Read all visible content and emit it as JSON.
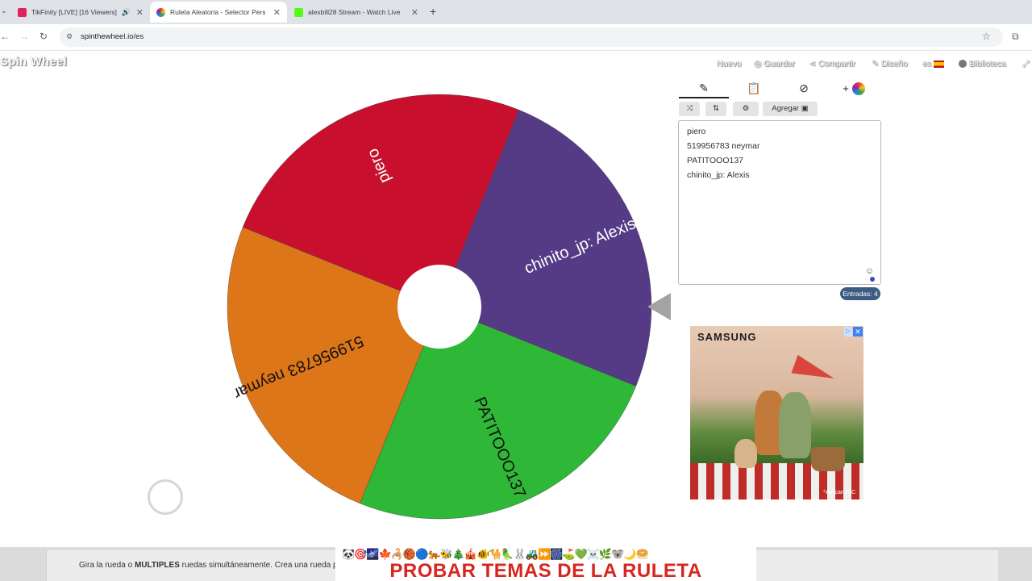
{
  "browser": {
    "tabs": [
      {
        "title": "TikFinity [LIVE] [16 Viewers]",
        "favicon_color": "#e0245e",
        "audio": true,
        "active": false
      },
      {
        "title": "Ruleta Aleatoria - Selector Pers",
        "favicon_color": "#f5a623",
        "audio": false,
        "active": true
      },
      {
        "title": "alexbill28 Stream - Watch Live",
        "favicon_color": "#53fc18",
        "audio": false,
        "active": false
      }
    ],
    "new_tab": "+",
    "url": "spinthewheel.io/es"
  },
  "header": {
    "logo": "Spin Wheel",
    "nav": {
      "new": "Nuevo",
      "save": "Guardar",
      "share": "Compartir",
      "design": "Diseño",
      "language": "es",
      "library": "Biblioteca"
    }
  },
  "wheel": {
    "segments": [
      {
        "label": "chinito_jp: Alexis",
        "color": "#553a85"
      },
      {
        "label": "PATITOOO137",
        "color": "#2fb738"
      },
      {
        "label": "519956783 neymar",
        "color": "#dd7519"
      },
      {
        "label": "piero",
        "color": "#c8102e"
      }
    ],
    "pointer_color": "#a3a3a3"
  },
  "editor": {
    "tabs": [
      "edit-icon",
      "clipboard-icon",
      "eye-off-icon",
      "add-color-icon"
    ],
    "toolbar": {
      "add_label": "Agregar"
    },
    "entries": [
      "piero",
      "519956783 neymar",
      "PATITOOO137",
      "chinito_jp: Alexis"
    ],
    "count_label": "Entradas: 4"
  },
  "ad": {
    "brand": "SAMSUNG",
    "disclaimer": "*Aplican TyC"
  },
  "footer": {
    "text_prefix": "Gira la rueda o ",
    "text_bold": "MÚLTIPLES",
    "text_suffix": " ruedas simultáneamente. Crea una rueda pe",
    "banner_emojis": "🐼🎯🌌🍁🦂🏀🔵🐅🐝🎄🎪🐠🐪🦜🐰🚜⏩🎆⛳💚☠️🌿🐨🌙🥯",
    "banner_text": "PROBAR TEMAS DE LA RULETA"
  }
}
